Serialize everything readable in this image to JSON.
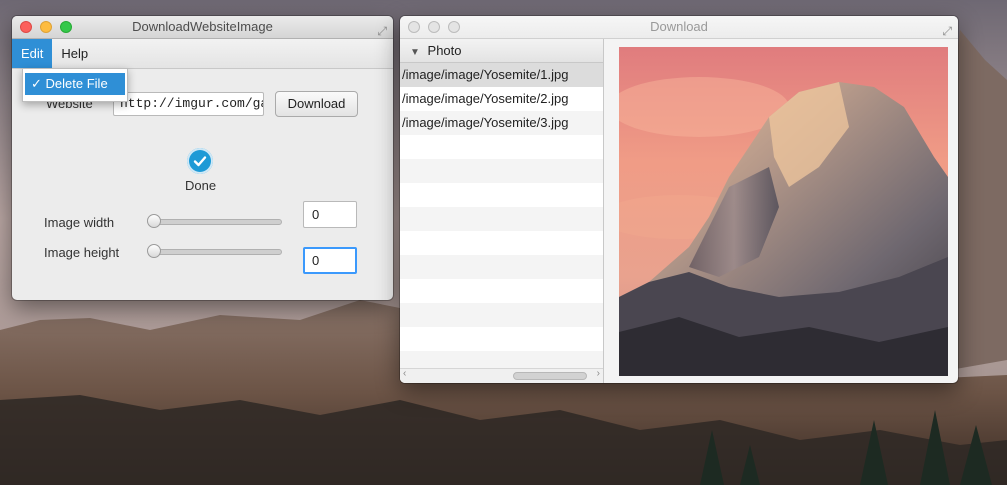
{
  "window_main": {
    "title": "DownloadWebsiteImage",
    "menus": [
      {
        "label": "Edit",
        "active": true
      },
      {
        "label": "Help",
        "active": false
      }
    ],
    "edit_menu": {
      "items": [
        {
          "label": "Delete File",
          "checked": true,
          "checkmark": "✓"
        }
      ]
    },
    "website_label": "Website",
    "website_value": "http://imgur.com/ga",
    "download_button": "Download",
    "status_text": "Done",
    "width_label": "Image width",
    "width_value": "0",
    "width_slider": 0,
    "height_label": "Image height",
    "height_value": "0",
    "height_slider": 0
  },
  "window_download": {
    "title": "Download",
    "column_header": "Photo",
    "files": [
      "/image/image/Yosemite/1.jpg",
      "/image/image/Yosemite/2.jpg",
      "/image/image/Yosemite/3.jpg"
    ],
    "selected_index": 0,
    "preview_icon": "mountain-photo"
  },
  "colors": {
    "accent": "#2f8fd6",
    "status_ok": "#1e9ad6",
    "focus_ring": "#3b99fc"
  }
}
